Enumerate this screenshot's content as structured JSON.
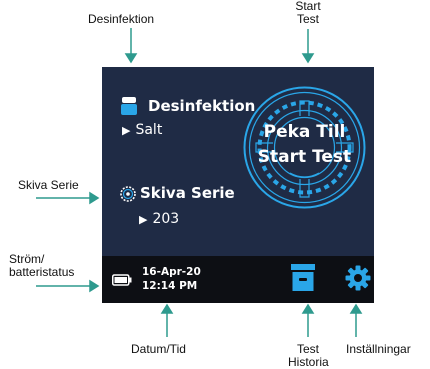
{
  "callouts": {
    "desinfektion": "Desinfektion",
    "start_test_line1": "Start",
    "start_test_line2": "Test",
    "skiva_serie": "Skiva Serie",
    "strom_line1": "Ström/",
    "strom_line2": "batteristatus",
    "datum_tid": "Datum/Tid",
    "test_historia_line1": "Test",
    "test_historia_line2": "Historia",
    "installningar": "Inställningar"
  },
  "screen": {
    "disinfection": {
      "label": "Desinfektion",
      "value": "Salt",
      "icon": "disinfectant-bottle-icon"
    },
    "disc_series": {
      "label": "Skiva Serie",
      "value": "203",
      "icon": "disc-icon"
    },
    "start_button": {
      "line1": "Peka Till",
      "line2": "Start Test"
    },
    "status_bar": {
      "date": "16-Apr-20",
      "time": "12:14 PM",
      "battery_icon": "battery-icon",
      "history_icon": "test-history-box-icon",
      "settings_icon": "gear-icon"
    },
    "colors": {
      "background": "#1f2b45",
      "status_bar": "#0d0f14",
      "accent": "#2aa6e8",
      "text": "#ffffff"
    }
  }
}
